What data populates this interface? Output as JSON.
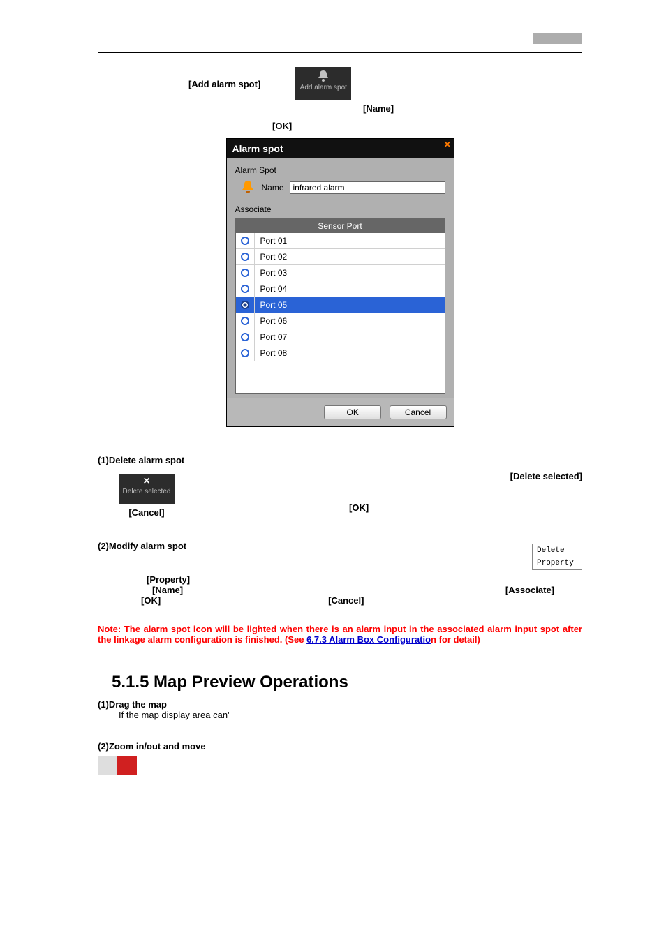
{
  "labels": {
    "add_alarm_spot": "[Add alarm spot]",
    "name": "[Name]",
    "ok": "[OK]",
    "cancel": "[Cancel]",
    "delete_selected": "[Delete selected]",
    "property": "[Property]",
    "associate": "[Associate]"
  },
  "tiles": {
    "add_alarm_spot": "Add alarm spot",
    "delete_selected": "Delete selected"
  },
  "dialog": {
    "title": "Alarm spot",
    "group_label": "Alarm Spot",
    "name_label": "Name",
    "name_value": "infrared alarm",
    "associate_label": "Associate",
    "column_header": "Sensor Port",
    "ports": [
      {
        "label": "Port 01",
        "selected": false
      },
      {
        "label": "Port 02",
        "selected": false
      },
      {
        "label": "Port 03",
        "selected": false
      },
      {
        "label": "Port 04",
        "selected": false
      },
      {
        "label": "Port 05",
        "selected": true
      },
      {
        "label": "Port 06",
        "selected": false
      },
      {
        "label": "Port 07",
        "selected": false
      },
      {
        "label": "Port 08",
        "selected": false
      }
    ],
    "ok": "OK",
    "cancel": "Cancel"
  },
  "sections": {
    "s1_title": "(1)Delete alarm spot",
    "s2_title": "(2)Modify alarm spot",
    "ctx_delete": "Delete",
    "ctx_property": "Property",
    "note_1": "Note: The alarm spot icon will be lighted when there is an alarm input in the associated alarm input spot after the linkage alarm configuration is finished. (See ",
    "note_link": "6.7.3 Alarm Box Configuratio",
    "note_2": "n for detail)",
    "h_515": "5.1.5 Map Preview Operations",
    "drag_title": "(1)Drag the map",
    "drag_body": "If the map display area can'",
    "zoom_title": "(2)Zoom in/out and move"
  }
}
